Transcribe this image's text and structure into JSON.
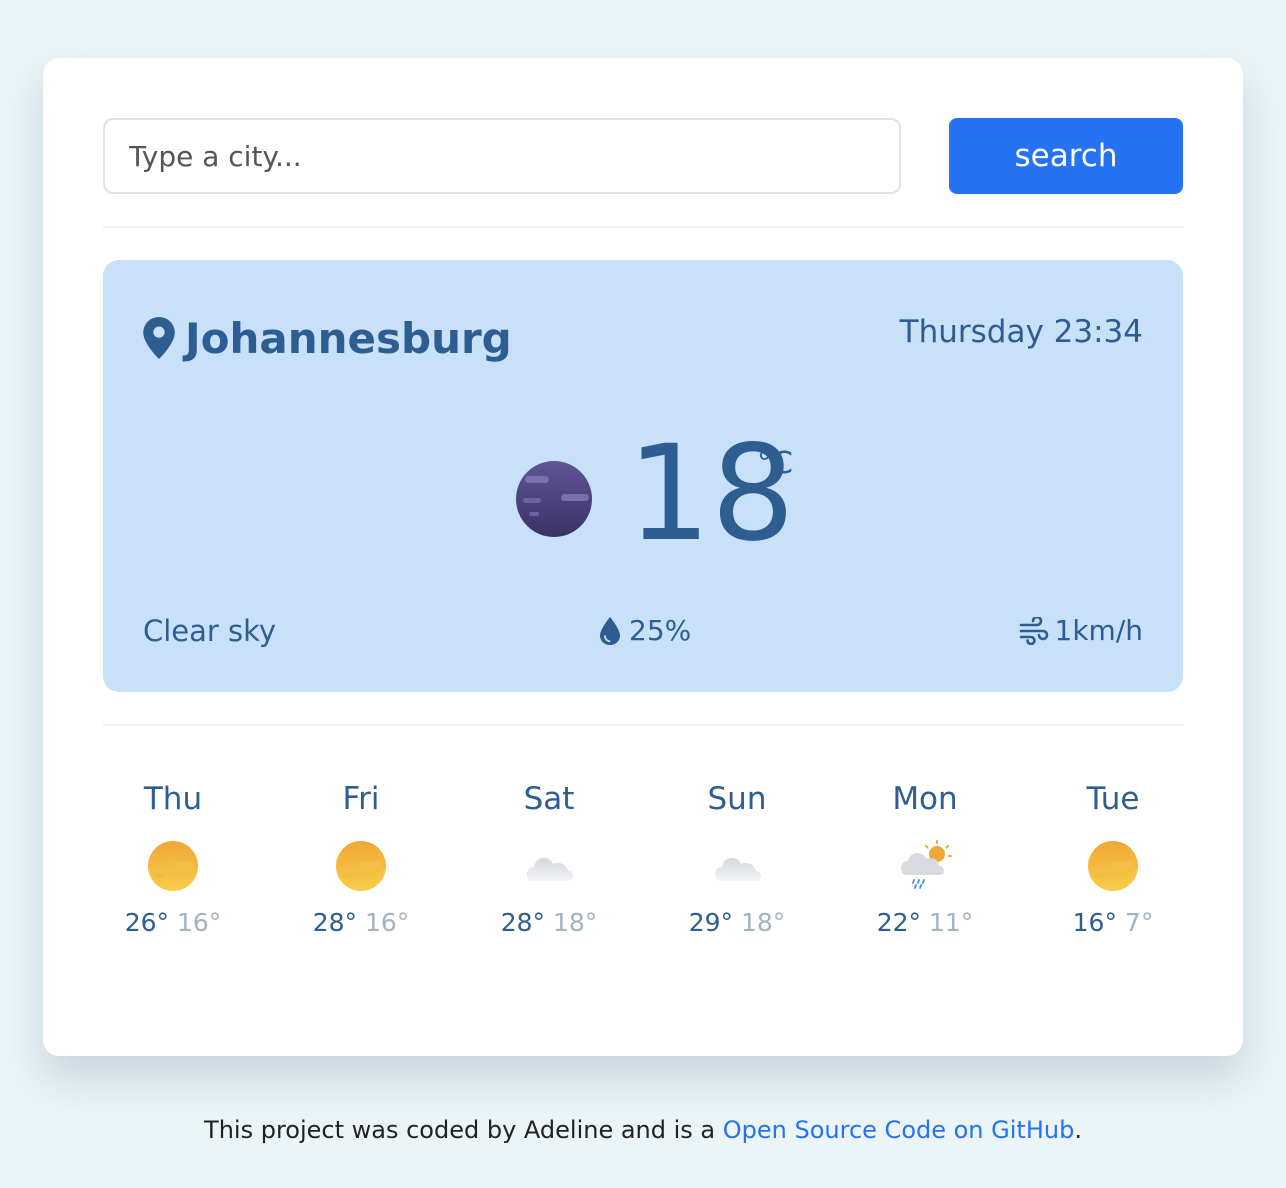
{
  "search": {
    "placeholder": "Type a city...",
    "button_label": "search"
  },
  "current": {
    "city": "Johannesburg",
    "datetime": "Thursday 23:34",
    "temperature": "18",
    "unit": "°C",
    "description": "Clear sky",
    "humidity": "25%",
    "wind": "1km/h",
    "icons": {
      "location": "location-pin-icon",
      "weather": "clear-night-moon-icon",
      "humidity": "water-drop-icon",
      "wind": "wind-icon"
    }
  },
  "forecast": [
    {
      "day": "Thu",
      "max": "26°",
      "min": "16°",
      "icon": "sun-icon"
    },
    {
      "day": "Fri",
      "max": "28°",
      "min": "16°",
      "icon": "sun-icon"
    },
    {
      "day": "Sat",
      "max": "28°",
      "min": "18°",
      "icon": "cloud-icon"
    },
    {
      "day": "Sun",
      "max": "29°",
      "min": "18°",
      "icon": "cloud-icon"
    },
    {
      "day": "Mon",
      "max": "22°",
      "min": "11°",
      "icon": "rain-sun-cloud-icon"
    },
    {
      "day": "Tue",
      "max": "16°",
      "min": "7°",
      "icon": "sun-icon"
    }
  ],
  "footer": {
    "text_before": "This project was coded by Adeline and is a ",
    "link_text": "Open Source Code on GitHub",
    "text_after": "."
  },
  "colors": {
    "background": "#ebf4f6",
    "card": "#ffffff",
    "accent": "#2573f3",
    "panel": "#c8e0f8",
    "primary_text": "#2e5d91",
    "muted_text": "#a3b3c4"
  }
}
